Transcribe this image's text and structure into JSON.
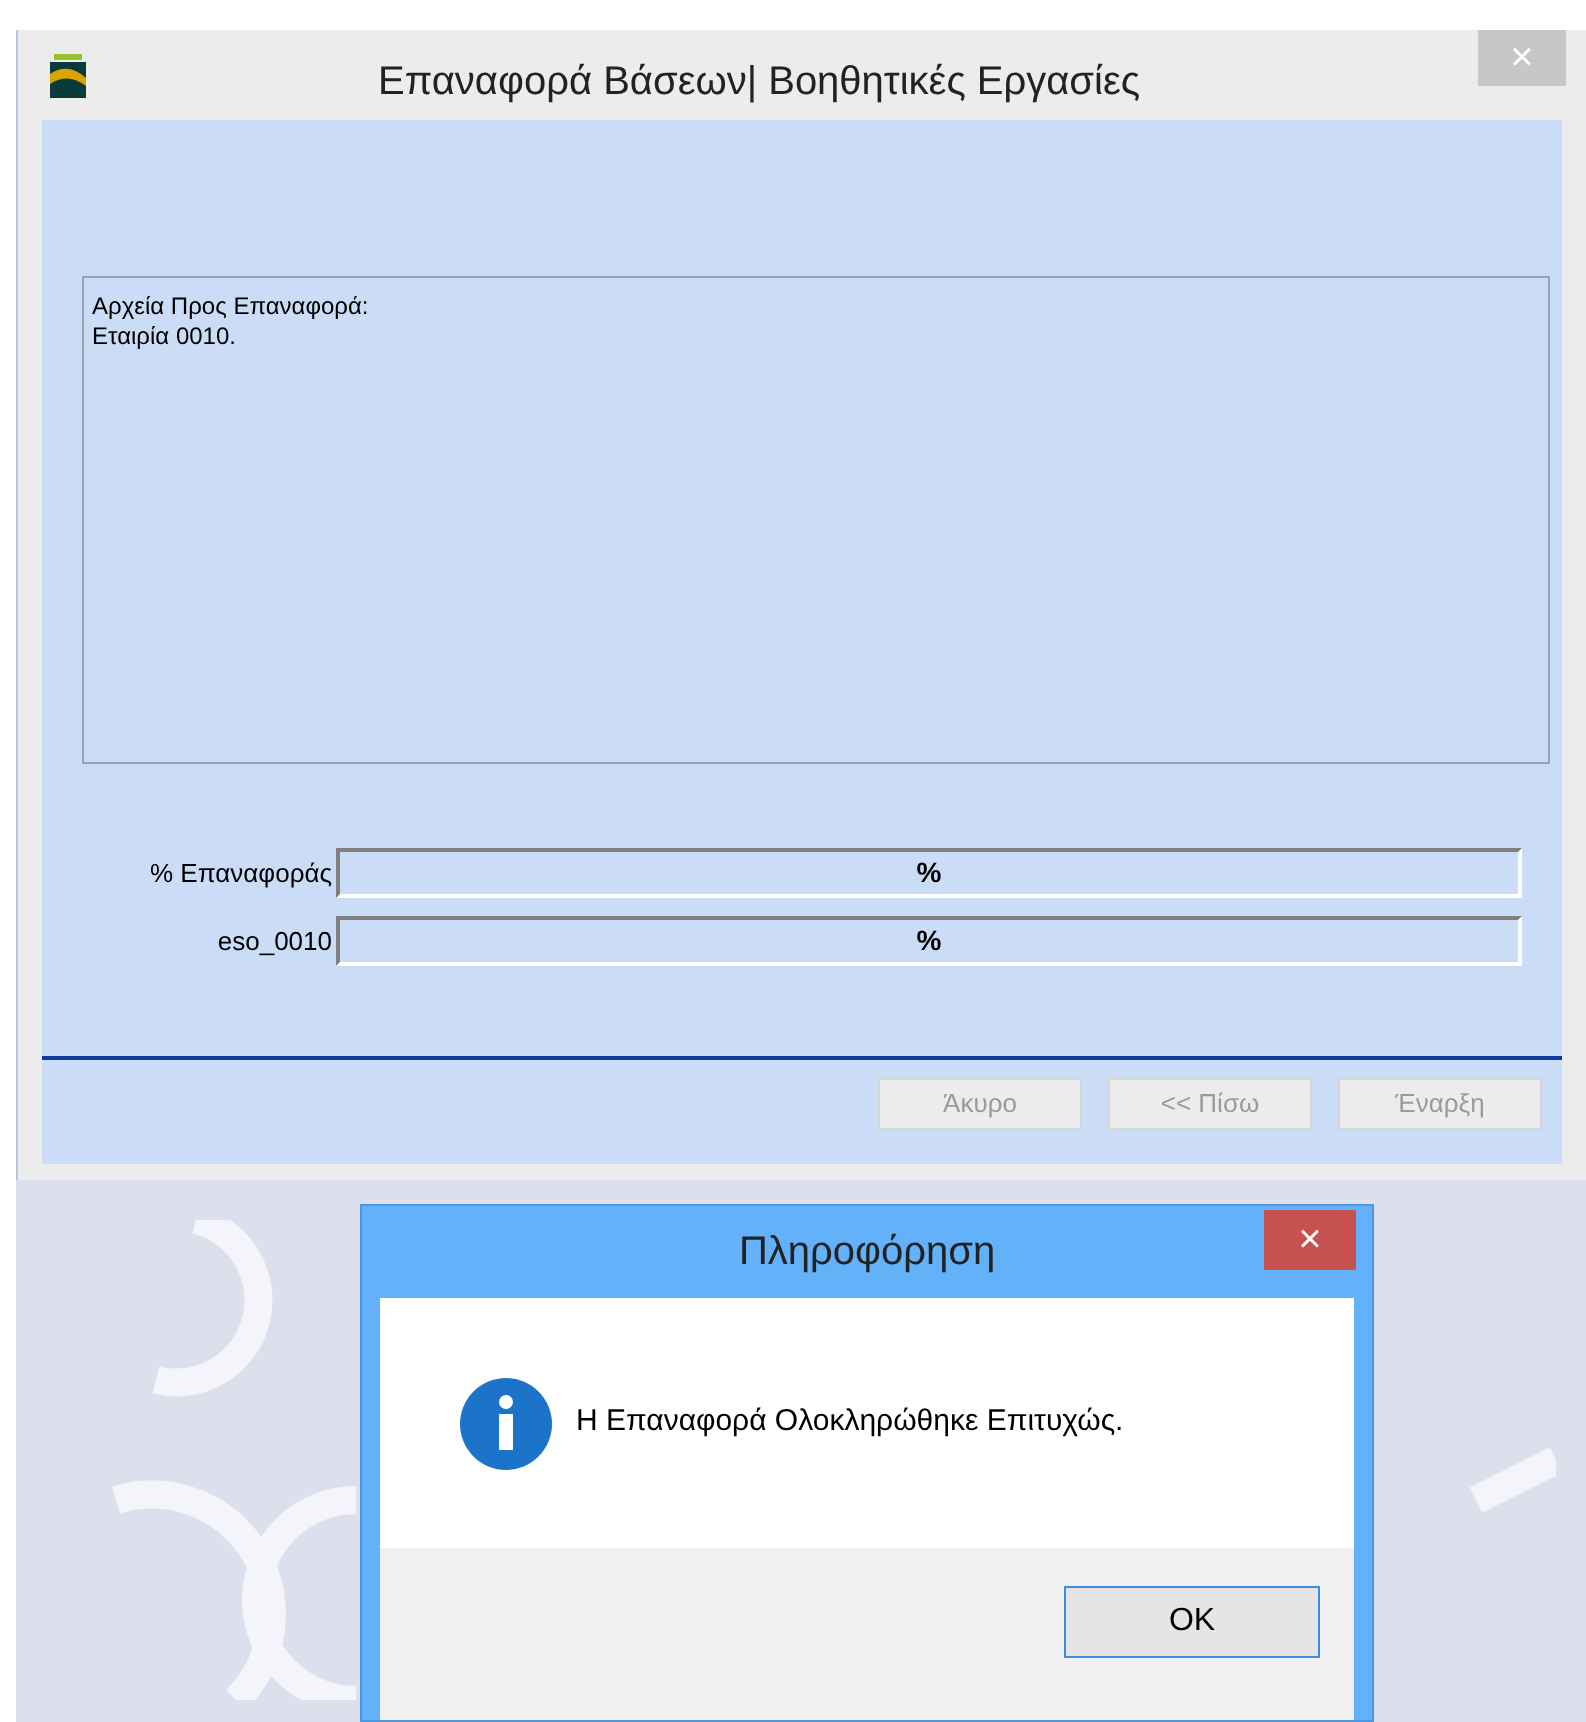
{
  "window": {
    "title": "Επαναφορά Βάσεων| Βοηθητικές Εργασίες",
    "close": "×"
  },
  "files_box": {
    "lines": [
      "Αρχεία Προς Επαναφορά:",
      "Εταιρία 0010."
    ]
  },
  "progress": [
    {
      "label": "% Επαναφοράς",
      "reading": "%",
      "level": 0
    },
    {
      "label": "eso_0010",
      "reading": "%",
      "level": 0
    }
  ],
  "buttons": [
    {
      "label": "Άκυρο",
      "disabled": true
    },
    {
      "label": "<< Πίσω",
      "disabled": true
    },
    {
      "label": "Έναρξη",
      "disabled": true
    }
  ],
  "dialog": {
    "title": "Πληροφόρηση",
    "close": "×",
    "message": "Η Επαναφορά Ολοκληρώθηκε Επιτυχώς.",
    "button": "OK"
  }
}
